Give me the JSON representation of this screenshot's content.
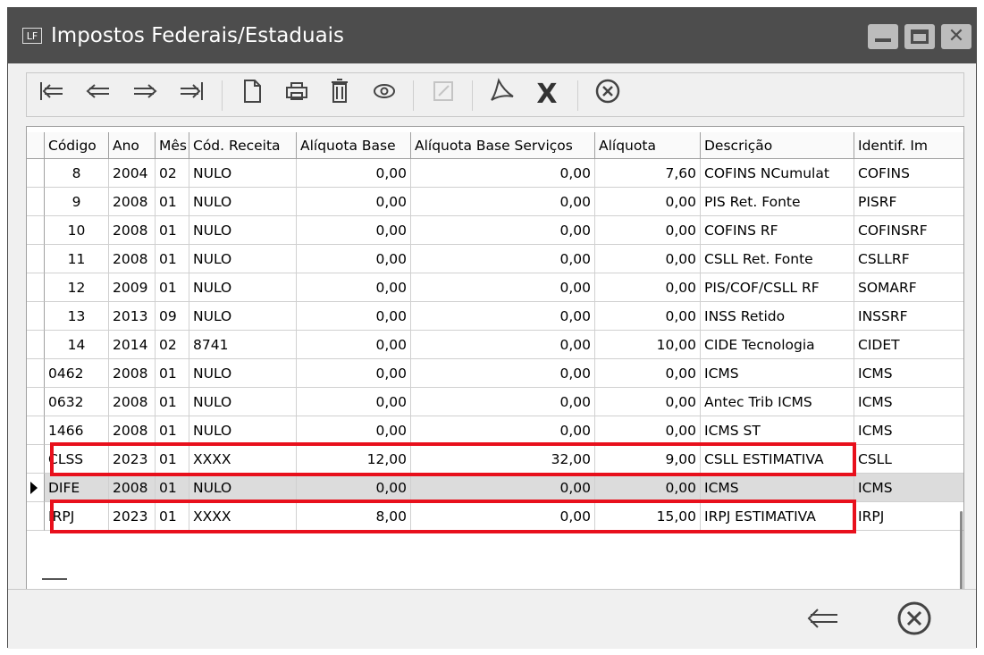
{
  "window": {
    "app_icon_text": "LF",
    "title": "Impostos Federais/Estaduais"
  },
  "toolbar": {
    "icons": [
      "first-record-icon",
      "previous-record-icon",
      "next-record-icon",
      "last-record-icon",
      "new-document-icon",
      "print-icon",
      "trash-icon",
      "view-eye-icon",
      "edit-icon",
      "pdf-icon",
      "excel-icon",
      "cancel-icon"
    ]
  },
  "grid": {
    "columns": [
      "Código",
      "Ano",
      "Mês",
      "Cód. Receita",
      "Alíquota Base",
      "Alíquota Base Serviços",
      "Alíquota",
      "Descrição",
      "Identif. Im"
    ],
    "rows": [
      [
        "8",
        "2004",
        "02",
        "NULO",
        "0,00",
        "0,00",
        "7,60",
        "COFINS NCumulat",
        "COFINS"
      ],
      [
        "9",
        "2008",
        "01",
        "NULO",
        "0,00",
        "0,00",
        "0,00",
        "PIS Ret. Fonte",
        "PISRF"
      ],
      [
        "10",
        "2008",
        "01",
        "NULO",
        "0,00",
        "0,00",
        "0,00",
        "COFINS RF",
        "COFINSRF"
      ],
      [
        "11",
        "2008",
        "01",
        "NULO",
        "0,00",
        "0,00",
        "0,00",
        "CSLL Ret. Fonte",
        "CSLLRF"
      ],
      [
        "12",
        "2009",
        "01",
        "NULO",
        "0,00",
        "0,00",
        "0,00",
        "PIS/COF/CSLL RF",
        "SOMARF"
      ],
      [
        "13",
        "2013",
        "09",
        "NULO",
        "0,00",
        "0,00",
        "0,00",
        "INSS Retido",
        "INSSRF"
      ],
      [
        "14",
        "2014",
        "02",
        "8741",
        "0,00",
        "0,00",
        "10,00",
        "CIDE Tecnologia",
        "CIDET"
      ],
      [
        "0462",
        "2008",
        "01",
        "NULO",
        "0,00",
        "0,00",
        "0,00",
        "ICMS",
        "ICMS"
      ],
      [
        "0632",
        "2008",
        "01",
        "NULO",
        "0,00",
        "0,00",
        "0,00",
        "Antec Trib ICMS",
        "ICMS"
      ],
      [
        "1466",
        "2008",
        "01",
        "NULO",
        "0,00",
        "0,00",
        "0,00",
        "ICMS ST",
        "ICMS"
      ],
      [
        "CLSS",
        "2023",
        "01",
        "XXXX",
        "12,00",
        "32,00",
        "9,00",
        "CSLL ESTIMATIVA",
        "CSLL"
      ],
      [
        "DIFE",
        "2008",
        "01",
        "NULO",
        "0,00",
        "0,00",
        "0,00",
        "ICMS",
        "ICMS"
      ],
      [
        "IRPJ",
        "2023",
        "01",
        "XXXX",
        "8,00",
        "0,00",
        "15,00",
        "IRPJ ESTIMATIVA",
        "IRPJ"
      ]
    ],
    "selected_row": 11,
    "highlighted_rows": [
      10,
      12
    ],
    "highlight_color": "#e8101c"
  },
  "footer": {
    "icons": [
      "back-arrow-icon",
      "close-circle-icon"
    ]
  }
}
